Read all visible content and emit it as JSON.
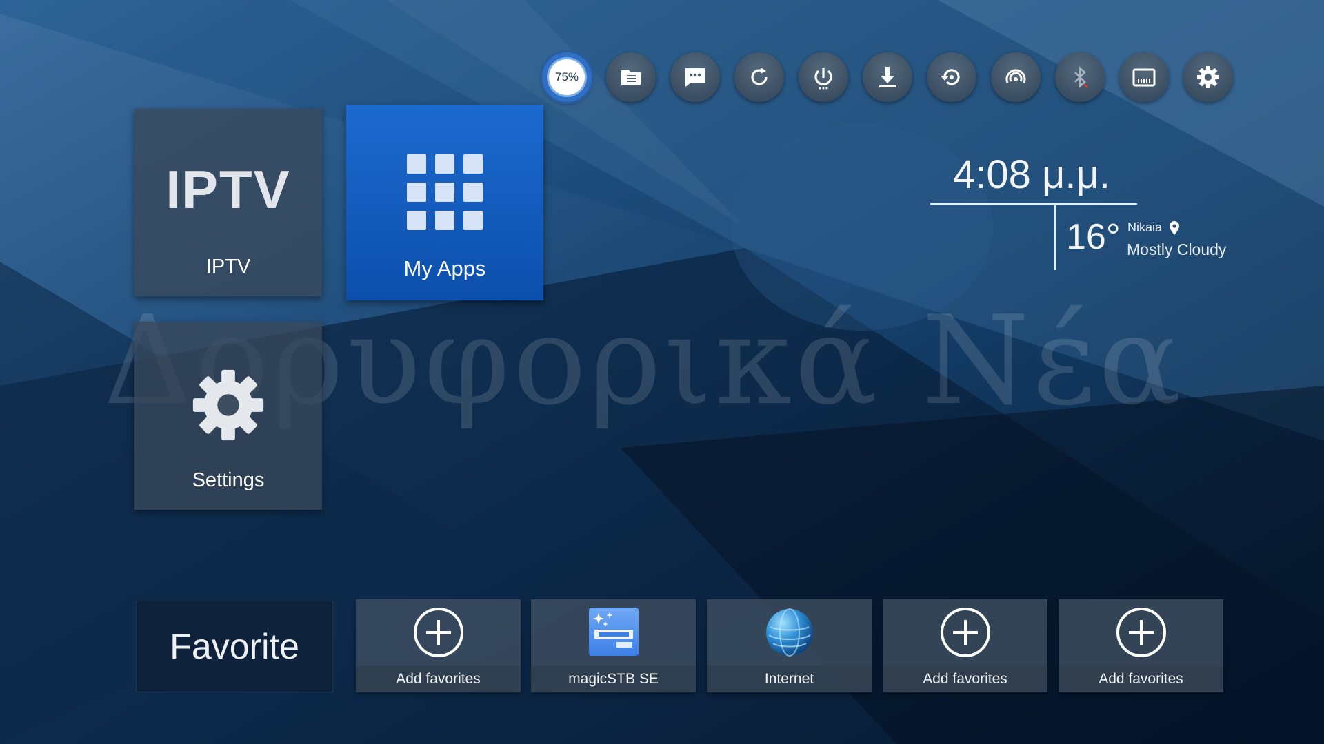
{
  "watermark": "Δορυφορικά Νέα",
  "topbar": {
    "storage_percent": "75%",
    "icons": [
      "storage-icon",
      "file-manager-icon",
      "messages-icon",
      "refresh-icon",
      "power-icon",
      "download-icon",
      "restore-icon",
      "network-icon",
      "bluetooth-icon",
      "display-icon",
      "settings-icon"
    ]
  },
  "tiles": {
    "iptv": {
      "logo_text": "IPTV",
      "label": "IPTV"
    },
    "my_apps": {
      "label": "My Apps"
    },
    "settings": {
      "label": "Settings"
    }
  },
  "clock": {
    "time": "4:08 μ.μ."
  },
  "weather": {
    "temperature": "16°",
    "city": "Nikaia",
    "condition": "Mostly Cloudy"
  },
  "favorites": {
    "title": "Favorite",
    "items": [
      {
        "label": "Add favorites",
        "icon": "add-icon"
      },
      {
        "label": "magicSTB SE",
        "icon": "magicstb-app-icon"
      },
      {
        "label": "Internet",
        "icon": "globe-icon"
      },
      {
        "label": "Add favorites",
        "icon": "add-icon"
      },
      {
        "label": "Add favorites",
        "icon": "add-icon"
      }
    ]
  },
  "colors": {
    "accent": "#1d6ad0",
    "tile": "#38485a",
    "background": "#0b2748"
  }
}
